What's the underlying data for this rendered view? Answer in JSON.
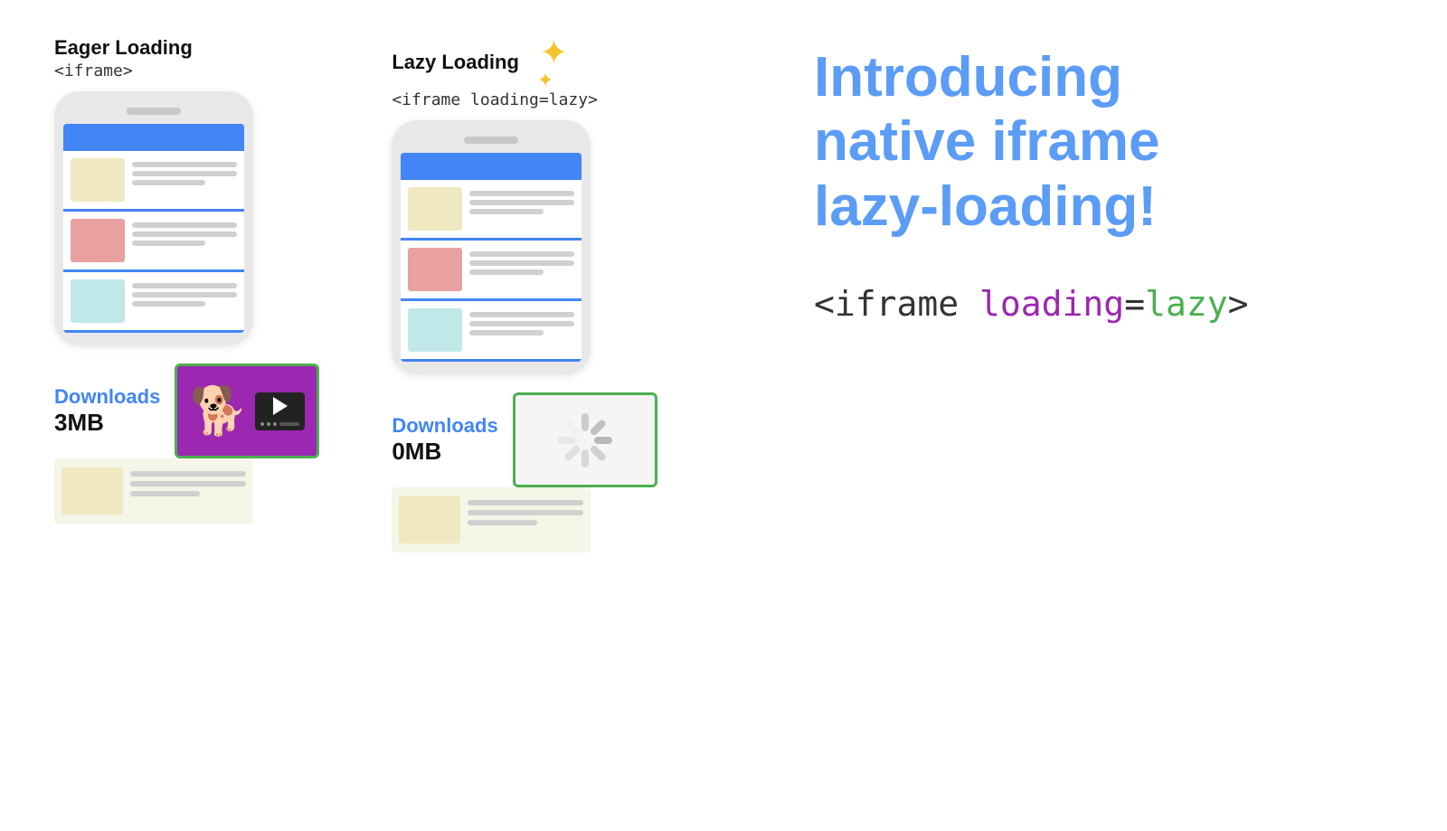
{
  "eager": {
    "title": "Eager Loading",
    "code_tag": "<iframe>",
    "downloads_label": "Downloads",
    "downloads_size": "3MB"
  },
  "lazy": {
    "title": "Lazy Loading",
    "code_tag": "<iframe loading=lazy>",
    "downloads_label": "Downloads",
    "downloads_size": "0MB"
  },
  "headline": {
    "line1": "Introducing",
    "line2": "native iframe",
    "line3": "lazy-loading!"
  },
  "code_snippet": {
    "full": "<iframe loading=lazy>",
    "part1": "<iframe ",
    "part2": "loading",
    "part3": "=",
    "part4": "lazy",
    "part5": ">"
  },
  "sparkle_char": "✦",
  "sparkle_small_char": "✦"
}
